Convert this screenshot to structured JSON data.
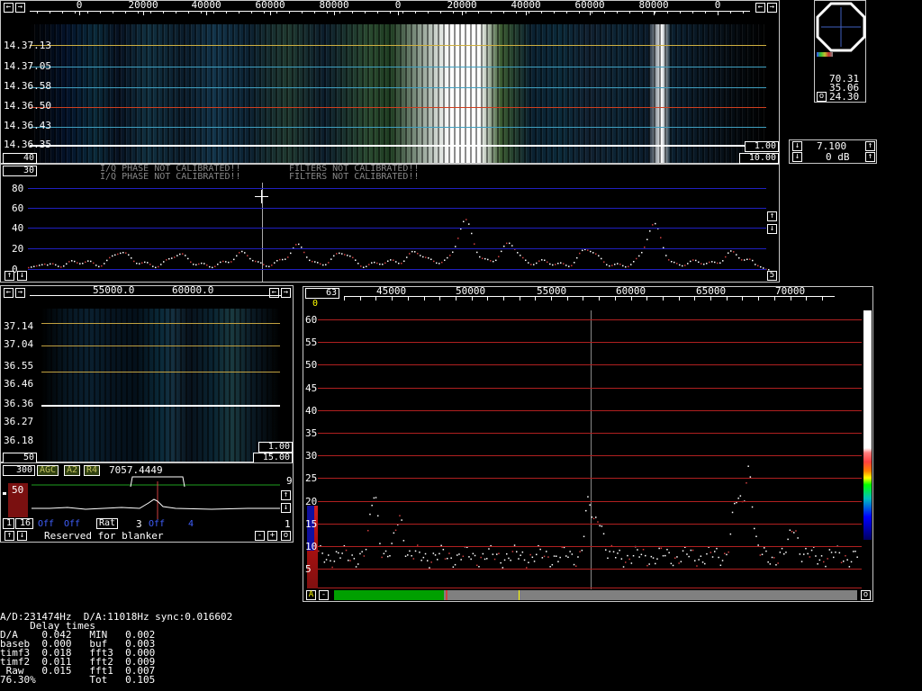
{
  "main_waterfall": {
    "top_scale": [
      "0",
      "20000",
      "40000",
      "60000",
      "80000",
      "0",
      "20000",
      "40000",
      "60000",
      "80000",
      "0"
    ],
    "times": [
      "14.37.13",
      "14.37.05",
      "14.36.58",
      "14.36.50",
      "14.36.43",
      "14.36.35"
    ],
    "left_value": "40",
    "right_value_top": "1.00",
    "right_value_bottom": "10.00"
  },
  "main_spectrum": {
    "top_value": "30",
    "warnings": [
      "I/Q PHASE NOT CALIBRATED!!",
      "I/Q PHASE NOT CALIBRATED!!"
    ],
    "filters": [
      "FILTERS NOT CALIBRATED!!",
      "FILTERS NOT CALIBRATED!!"
    ],
    "y_ticks": [
      "80",
      "60",
      "40",
      "20",
      "0"
    ],
    "right_value": "5"
  },
  "meter": {
    "values": [
      "70.31",
      "35.06",
      "24.30"
    ],
    "o_button": "o"
  },
  "freq_controls": {
    "freq": "7.100",
    "gain": "0 dB"
  },
  "bb_waterfall": {
    "scale": [
      "55000.0",
      "60000.0"
    ],
    "times": [
      "37.14",
      "37.04",
      "36.55",
      "36.46",
      "36.36",
      "36.27",
      "36.18"
    ],
    "left_value": "50",
    "right_value_top": "1.00",
    "right_value_bottom": "15.00"
  },
  "bb_controls": {
    "bw": "300",
    "agc": "AGC",
    "a2": "A2",
    "r4": "R4",
    "freq": "7057.4449",
    "right_num": "9",
    "level": "50",
    "n1": "1",
    "n16": "16",
    "off1": "Off",
    "off2": "Off",
    "rat_label": "Rat",
    "rat_val": "3",
    "off3": "Off",
    "off3_val": "4",
    "one": "1",
    "reserved": "Reserved for blanker",
    "minus": "-",
    "plus": "+",
    "o": "o"
  },
  "hires": {
    "top_value": "63",
    "zero": "0",
    "x_ticks": [
      "45000",
      "50000",
      "55000",
      "60000",
      "65000",
      "70000"
    ],
    "y_ticks": [
      "60",
      "55",
      "50",
      "45",
      "40",
      "35",
      "30",
      "25",
      "20",
      "15",
      "10",
      "5"
    ],
    "a_button": "A",
    "minus_button": "-",
    "o_button": "o"
  },
  "stats": {
    "line1": "A/D:231474Hz  D/A:11018Hz sync:0.016602",
    "line2": "     Delay times",
    "rows": [
      "D/A    0.042   MIN   0.002",
      "baseb  0.000   buf   0.003",
      "timf3  0.018   fft3  0.000",
      "timf2  0.011   fft2  0.009",
      " Raw   0.015   fft1  0.007",
      "76.30%         Tot   0.105"
    ]
  },
  "colors": {
    "grid_blue": "#2020c0",
    "grid_red": "#b02020",
    "green_bar": "#00a000",
    "gray_bar": "#808080"
  }
}
